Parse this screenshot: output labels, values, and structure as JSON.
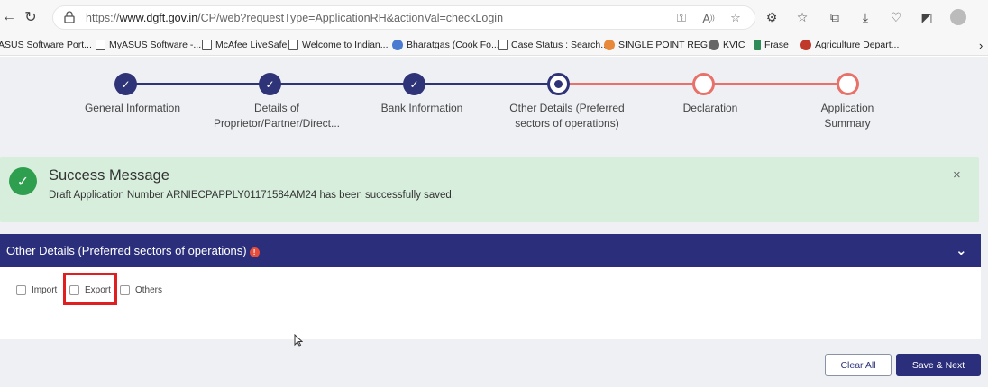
{
  "browser": {
    "url_prefix": "https://",
    "url_domain": "www.dgft.gov.in",
    "url_path": "/CP/web?requestType=ApplicationRH&actionVal=checkLogin",
    "bookmarks": [
      {
        "label": "ASUS Software Port...",
        "icon": "page-icon"
      },
      {
        "label": "MyASUS Software -...",
        "icon": "page-icon"
      },
      {
        "label": "McAfee LiveSafe",
        "icon": "page-icon"
      },
      {
        "label": "Welcome to Indian...",
        "icon": "page-icon"
      },
      {
        "label": "Bharatgas (Cook Fo...",
        "icon": "globe-icon"
      },
      {
        "label": "Case Status : Search...",
        "icon": "page-icon"
      },
      {
        "label": "SINGLE POINT REGI...",
        "icon": "emblem-icon"
      },
      {
        "label": "KVIC",
        "icon": "kvic-icon"
      },
      {
        "label": "Frase",
        "icon": "frase-icon"
      },
      {
        "label": "Agriculture Depart...",
        "icon": "emblem-icon"
      }
    ]
  },
  "stepper": {
    "steps": [
      {
        "label": "General Information",
        "state": "done"
      },
      {
        "label": "Details of Proprietor/Partner/Direct...",
        "state": "done"
      },
      {
        "label": "Bank Information",
        "state": "done"
      },
      {
        "label": "Other Details (Preferred sectors of operations)",
        "state": "current"
      },
      {
        "label": "Declaration",
        "state": "todo"
      },
      {
        "label": "Application Summary",
        "state": "todo"
      }
    ],
    "colors": {
      "done": "#2f3478",
      "todo": "#e8716a"
    }
  },
  "alert": {
    "title": "Success Message",
    "message": "Draft Application Number ARNIECPAPPLY01171584AM24 has been successfully saved.",
    "close": "×"
  },
  "section": {
    "title": "Other Details (Preferred sectors of operations)",
    "options": [
      {
        "label": "Import",
        "checked": false
      },
      {
        "label": "Export",
        "checked": false
      },
      {
        "label": "Others",
        "checked": false
      }
    ]
  },
  "buttons": {
    "clear": "Clear All",
    "save": "Save & Next"
  }
}
